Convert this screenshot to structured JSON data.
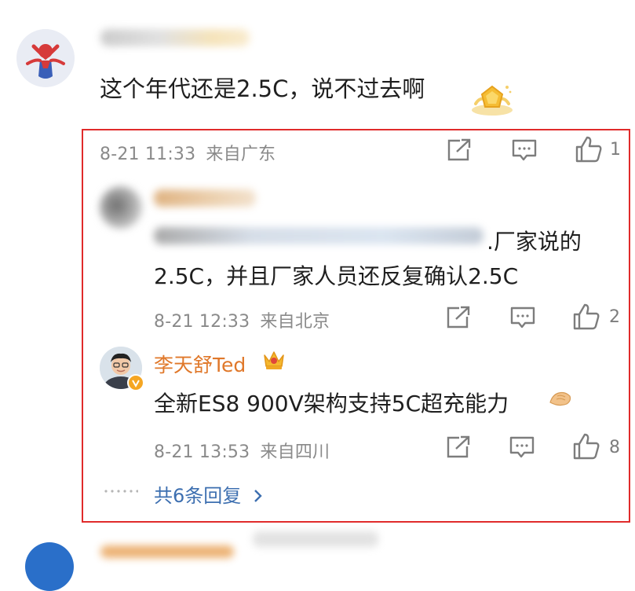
{
  "top_comment": {
    "text": "这个年代还是2.5C，说不过去啊"
  },
  "highlight": {
    "color": "#e02b2b"
  },
  "actions_a": {
    "time": "8-21 11:33",
    "location": "来自广东",
    "like_count": "1"
  },
  "reply1": {
    "text_end": ".厂家说的",
    "text_line2": "2.5C，并且厂家人员还反复确认2.5C",
    "time": "8-21 12:33",
    "location": "来自北京",
    "like_count": "2"
  },
  "reply2": {
    "username": "李天舒Ted",
    "text": "全新ES8 900V架构支持5C超充能力",
    "time": "8-21 13:53",
    "location": "来自四川",
    "like_count": "8"
  },
  "more_replies": {
    "label": "共6条回复"
  },
  "colors": {
    "username_orange": "#e0782a",
    "link_blue": "#3d6fb0",
    "meta_gray": "#8a8a8a"
  }
}
